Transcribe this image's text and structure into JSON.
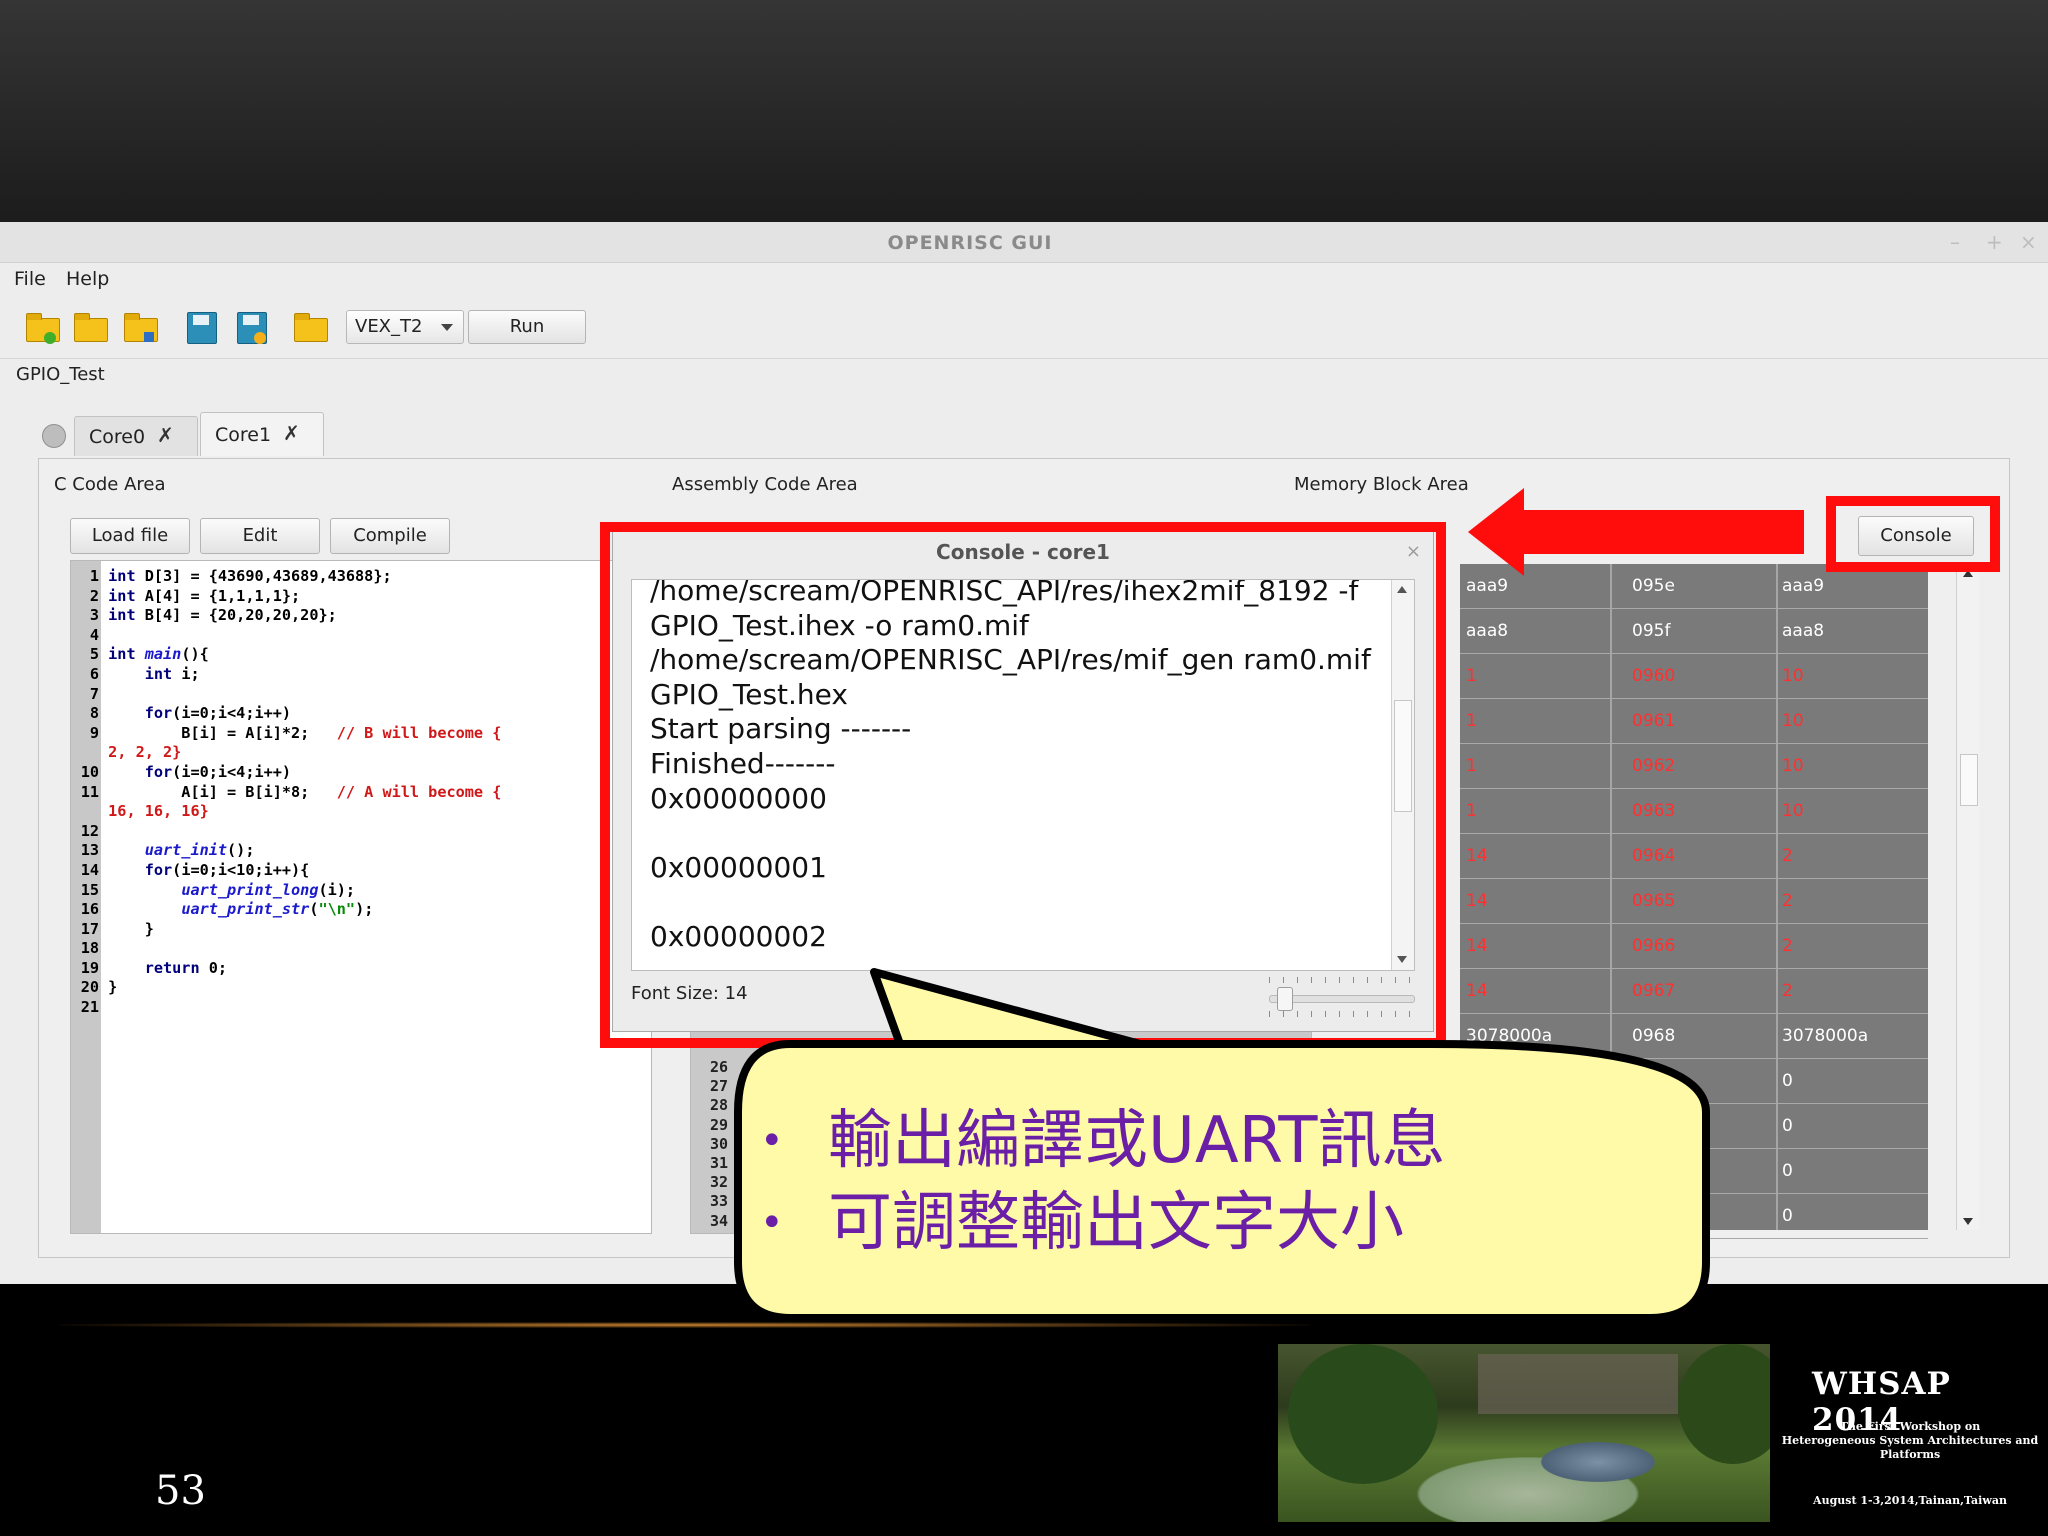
{
  "window": {
    "title": "OPENRISC GUI",
    "controls": [
      "–",
      "+",
      "×"
    ]
  },
  "menu": {
    "items": [
      "File",
      "Help"
    ]
  },
  "toolbar": {
    "icons": [
      "new-folder-icon",
      "open-folder-icon",
      "folder-settings-icon",
      "save-icon",
      "save-as-icon",
      "folder-icon"
    ],
    "target_select": "VEX_T2",
    "run_label": "Run"
  },
  "project": {
    "name": "GPIO_Test"
  },
  "tabs": [
    {
      "label": "Core0",
      "close": "✗"
    },
    {
      "label": "Core1",
      "close": "✗"
    }
  ],
  "areas": {
    "c_code": "C Code Area",
    "assembly": "Assembly Code Area",
    "memory": "Memory Block Area"
  },
  "buttons": {
    "load_file": "Load file",
    "edit": "Edit",
    "compile": "Compile",
    "console": "Console"
  },
  "code_lines": [
    "int D[3] = {43690,43689,43688};",
    "int A[4] = {1,1,1,1};",
    "int B[4] = {20,20,20,20};",
    "",
    "int main(){",
    "    int i;",
    "",
    "    for(i=0;i<4;i++)",
    "        B[i] = A[i]*2;   // B will become {",
    "2, 2, 2}",
    "    for(i=0;i<4;i++)",
    "        A[i] = B[i]*8;   // A will become {",
    "16, 16, 16}",
    "",
    "    uart_init();",
    "    for(i=0;i<10;i++){",
    "        uart_print_long(i);",
    "        uart_print_str(\"\\n\");",
    "    }",
    "",
    "    return 0;",
    "}",
    ""
  ],
  "asm_line_numbers": [
    "26",
    "27",
    "28",
    "29",
    "30",
    "31",
    "32",
    "33",
    "34"
  ],
  "memory_rows": [
    {
      "a": "aaa9",
      "b": "095e",
      "c": "aaa9",
      "red": false
    },
    {
      "a": "aaa8",
      "b": "095f",
      "c": "aaa8",
      "red": false
    },
    {
      "a": "1",
      "b": "0960",
      "c": "10",
      "red": true
    },
    {
      "a": "1",
      "b": "0961",
      "c": "10",
      "red": true
    },
    {
      "a": "1",
      "b": "0962",
      "c": "10",
      "red": true
    },
    {
      "a": "1",
      "b": "0963",
      "c": "10",
      "red": true
    },
    {
      "a": "14",
      "b": "0964",
      "c": "2",
      "red": true
    },
    {
      "a": "14",
      "b": "0965",
      "c": "2",
      "red": true
    },
    {
      "a": "14",
      "b": "0966",
      "c": "2",
      "red": true
    },
    {
      "a": "14",
      "b": "0967",
      "c": "2",
      "red": true
    },
    {
      "a": "3078000a",
      "b": "0968",
      "c": "3078000a",
      "red": false
    },
    {
      "a": "",
      "b": "",
      "c": "0",
      "red": false
    },
    {
      "a": "",
      "b": "",
      "c": "0",
      "red": false
    },
    {
      "a": "",
      "b": "",
      "c": "0",
      "red": false
    },
    {
      "a": "",
      "b": "",
      "c": "0",
      "red": false
    }
  ],
  "console": {
    "title": "Console - core1",
    "close": "×",
    "lines": [
      "/home/scream/OPENRISC_API/res/ihex2mif_8192 -f",
      "GPIO_Test.ihex -o ram0.mif",
      "/home/scream/OPENRISC_API/res/mif_gen ram0.mif",
      "GPIO_Test.hex",
      "Start parsing -------",
      "Finished-------",
      "0x00000000",
      "",
      "0x00000001",
      "",
      "0x00000002"
    ],
    "font_size_label": "Font Size: 14",
    "font_size_value": 14
  },
  "callout": {
    "bullets": [
      "輸出編譯或UART訊息",
      "可調整輸出文字大小"
    ],
    "fill": "#fffaa8",
    "text_color": "#6a1fa6"
  },
  "slide": {
    "number": "53",
    "badge_title": "WHSAP   2014",
    "badge_sub1": "The First Workshop on",
    "badge_sub2": "Heterogeneous System Architectures and Platforms",
    "badge_date": "August 1-3,2014,Tainan,Taiwan"
  },
  "highlight_color": "#ff0c0c"
}
